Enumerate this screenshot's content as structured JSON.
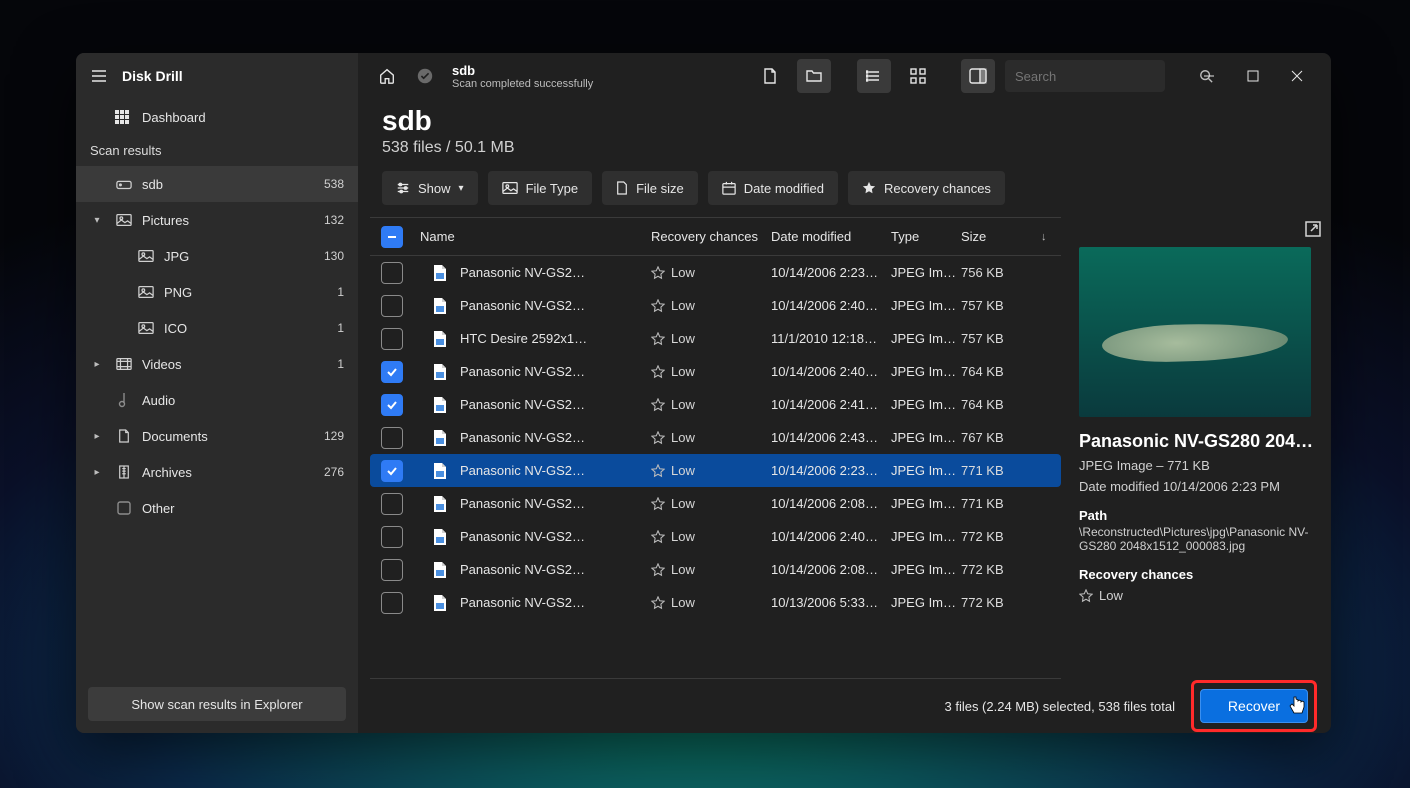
{
  "app": {
    "title": "Disk Drill"
  },
  "sidebar": {
    "dashboard": "Dashboard",
    "section": "Scan results",
    "tree": [
      {
        "icon": "disk",
        "label": "sdb",
        "count": "538",
        "level": 0,
        "chev": "",
        "active": true
      },
      {
        "icon": "image",
        "label": "Pictures",
        "count": "132",
        "level": 0,
        "chev": "down"
      },
      {
        "icon": "image",
        "label": "JPG",
        "count": "130",
        "level": 1,
        "chev": ""
      },
      {
        "icon": "image",
        "label": "PNG",
        "count": "1",
        "level": 1,
        "chev": ""
      },
      {
        "icon": "image",
        "label": "ICO",
        "count": "1",
        "level": 1,
        "chev": ""
      },
      {
        "icon": "video",
        "label": "Videos",
        "count": "1",
        "level": 0,
        "chev": "right"
      },
      {
        "icon": "audio",
        "label": "Audio",
        "count": "",
        "level": 0,
        "chev": ""
      },
      {
        "icon": "document",
        "label": "Documents",
        "count": "129",
        "level": 0,
        "chev": "right"
      },
      {
        "icon": "archive",
        "label": "Archives",
        "count": "276",
        "level": 0,
        "chev": "right"
      },
      {
        "icon": "other",
        "label": "Other",
        "count": "",
        "level": 0,
        "chev": ""
      }
    ],
    "footer_btn": "Show scan results in Explorer"
  },
  "topbar": {
    "crumb_title": "sdb",
    "crumb_sub": "Scan completed successfully",
    "search_placeholder": "Search"
  },
  "header": {
    "title": "sdb",
    "sub": "538 files / 50.1 MB"
  },
  "filters": {
    "show": "Show",
    "file_type": "File Type",
    "file_size": "File size",
    "date_modified": "Date modified",
    "recovery_chances": "Recovery chances"
  },
  "columns": {
    "name": "Name",
    "recovery": "Recovery chances",
    "date": "Date modified",
    "type": "Type",
    "size": "Size"
  },
  "rows": [
    {
      "name": "Panasonic NV-GS2…",
      "rec": "Low",
      "date": "10/14/2006 2:23…",
      "type": "JPEG Im…",
      "size": "756 KB",
      "chk": false,
      "sel": false
    },
    {
      "name": "Panasonic NV-GS2…",
      "rec": "Low",
      "date": "10/14/2006 2:40…",
      "type": "JPEG Im…",
      "size": "757 KB",
      "chk": false,
      "sel": false
    },
    {
      "name": "HTC Desire 2592x1…",
      "rec": "Low",
      "date": "11/1/2010 12:18…",
      "type": "JPEG Im…",
      "size": "757 KB",
      "chk": false,
      "sel": false
    },
    {
      "name": "Panasonic NV-GS2…",
      "rec": "Low",
      "date": "10/14/2006 2:40…",
      "type": "JPEG Im…",
      "size": "764 KB",
      "chk": true,
      "sel": false
    },
    {
      "name": "Panasonic NV-GS2…",
      "rec": "Low",
      "date": "10/14/2006 2:41…",
      "type": "JPEG Im…",
      "size": "764 KB",
      "chk": true,
      "sel": false
    },
    {
      "name": "Panasonic NV-GS2…",
      "rec": "Low",
      "date": "10/14/2006 2:43…",
      "type": "JPEG Im…",
      "size": "767 KB",
      "chk": false,
      "sel": false
    },
    {
      "name": "Panasonic NV-GS2…",
      "rec": "Low",
      "date": "10/14/2006 2:23…",
      "type": "JPEG Im…",
      "size": "771 KB",
      "chk": true,
      "sel": true
    },
    {
      "name": "Panasonic NV-GS2…",
      "rec": "Low",
      "date": "10/14/2006 2:08…",
      "type": "JPEG Im…",
      "size": "771 KB",
      "chk": false,
      "sel": false
    },
    {
      "name": "Panasonic NV-GS2…",
      "rec": "Low",
      "date": "10/14/2006 2:40…",
      "type": "JPEG Im…",
      "size": "772 KB",
      "chk": false,
      "sel": false
    },
    {
      "name": "Panasonic NV-GS2…",
      "rec": "Low",
      "date": "10/14/2006 2:08…",
      "type": "JPEG Im…",
      "size": "772 KB",
      "chk": false,
      "sel": false
    },
    {
      "name": "Panasonic NV-GS2…",
      "rec": "Low",
      "date": "10/13/2006 5:33…",
      "type": "JPEG Im…",
      "size": "772 KB",
      "chk": false,
      "sel": false
    }
  ],
  "details": {
    "title": "Panasonic NV-GS280 204…",
    "meta": "JPEG Image – 771 KB",
    "modified": "Date modified 10/14/2006 2:23 PM",
    "path_label": "Path",
    "path": "\\Reconstructed\\Pictures\\jpg\\Panasonic NV-GS280 2048x1512_000083.jpg",
    "rec_label": "Recovery chances",
    "rec_value": "Low"
  },
  "status": {
    "text": "3 files (2.24 MB) selected, 538 files total",
    "recover": "Recover"
  }
}
